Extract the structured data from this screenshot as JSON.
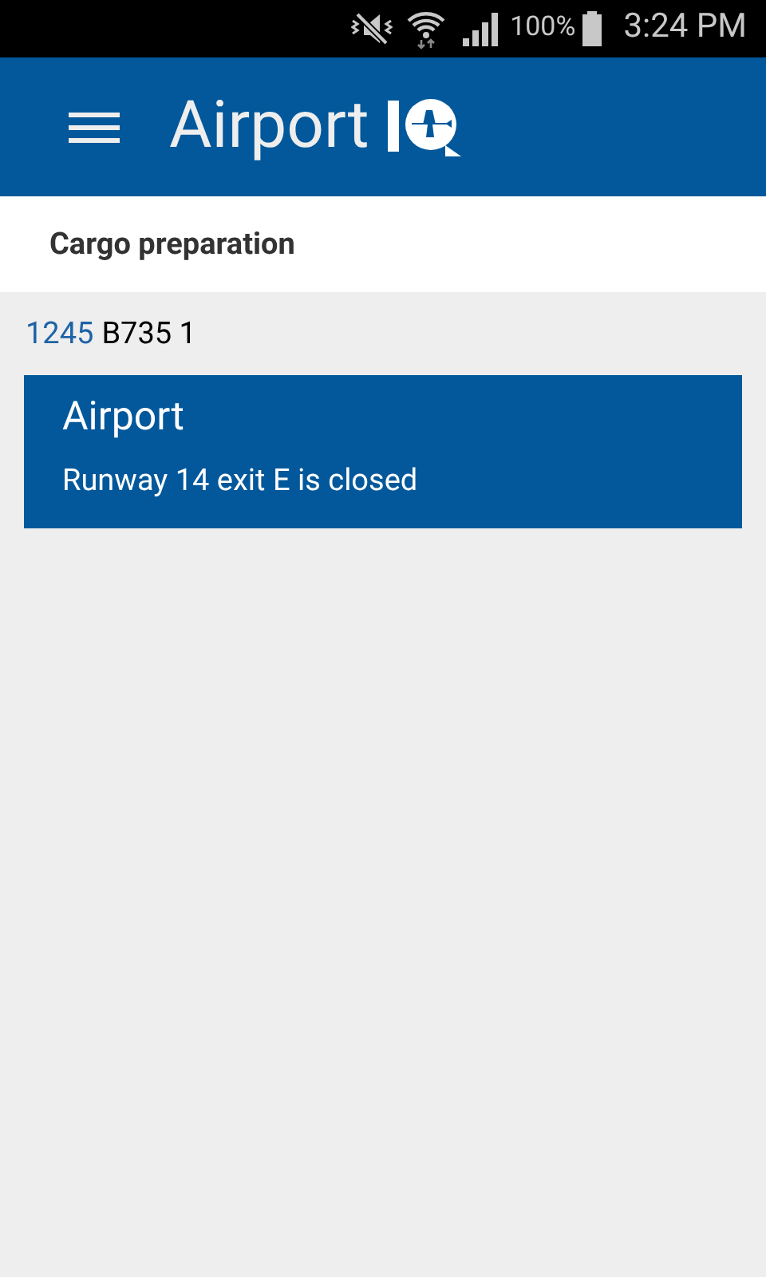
{
  "status_bar": {
    "battery": "100%",
    "time": "3:24 PM"
  },
  "app_bar": {
    "title": "Airport"
  },
  "section": {
    "title": "Cargo preparation"
  },
  "flight": {
    "number": "1245",
    "detail": "B735 1"
  },
  "alerts": [
    {
      "title": "Airport",
      "message": "Runway 14 exit E is closed"
    }
  ]
}
